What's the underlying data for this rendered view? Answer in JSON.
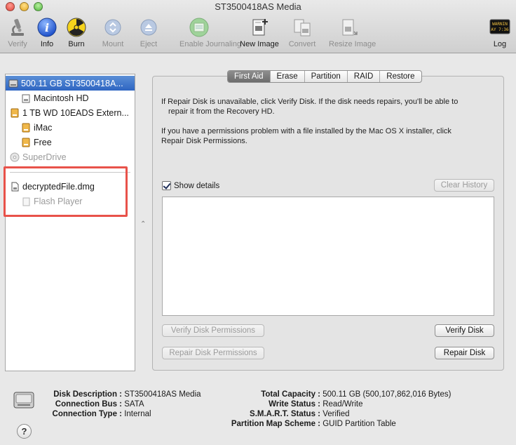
{
  "window": {
    "title": "ST3500418AS Media"
  },
  "toolbar": {
    "verify": "Verify",
    "info": "Info",
    "burn": "Burn",
    "mount": "Mount",
    "eject": "Eject",
    "enable_journaling": "Enable Journaling",
    "new_image": "New Image",
    "convert": "Convert",
    "resize_image": "Resize Image",
    "log": "Log",
    "log_icon_text": "WARNIN\nAY 7:36"
  },
  "sidebar": {
    "items": [
      {
        "label": "500.11 GB ST3500418A...",
        "icon": "hard-disk-icon"
      },
      {
        "label": "Macintosh HD",
        "icon": "volume-icon"
      },
      {
        "label": "1 TB WD 10EADS Extern...",
        "icon": "external-disk-icon"
      },
      {
        "label": "iMac",
        "icon": "volume-icon"
      },
      {
        "label": "Free",
        "icon": "volume-icon"
      },
      {
        "label": "SuperDrive",
        "icon": "optical-drive-icon"
      },
      {
        "label": "decryptedFile.dmg",
        "icon": "disk-image-icon"
      },
      {
        "label": "Flash Player",
        "icon": "volume-icon"
      }
    ]
  },
  "tabs": [
    "First Aid",
    "Erase",
    "Partition",
    "RAID",
    "Restore"
  ],
  "first_aid": {
    "para1": "If Repair Disk is unavailable, click Verify Disk. If the disk needs repairs, you'll be able to",
    "para1b": "repair it from the Recovery HD.",
    "para2": "If you have a permissions problem with a file installed by the Mac OS X installer, click",
    "para2b": "Repair Disk Permissions.",
    "show_details": "Show details",
    "clear_history": "Clear History",
    "verify_permissions": "Verify Disk Permissions",
    "repair_permissions": "Repair Disk Permissions",
    "verify_disk": "Verify Disk",
    "repair_disk": "Repair Disk"
  },
  "info": {
    "left": [
      {
        "k": "Disk Description :",
        "v": "ST3500418AS Media"
      },
      {
        "k": "Connection Bus :",
        "v": "SATA"
      },
      {
        "k": "Connection Type :",
        "v": "Internal"
      }
    ],
    "right": [
      {
        "k": "Total Capacity :",
        "v": "500.11 GB (500,107,862,016 Bytes)"
      },
      {
        "k": "Write Status :",
        "v": "Read/Write"
      },
      {
        "k": "S.M.A.R.T. Status :",
        "v": "Verified"
      },
      {
        "k": "Partition Map Scheme :",
        "v": "GUID Partition Table"
      }
    ],
    "help": "?"
  }
}
